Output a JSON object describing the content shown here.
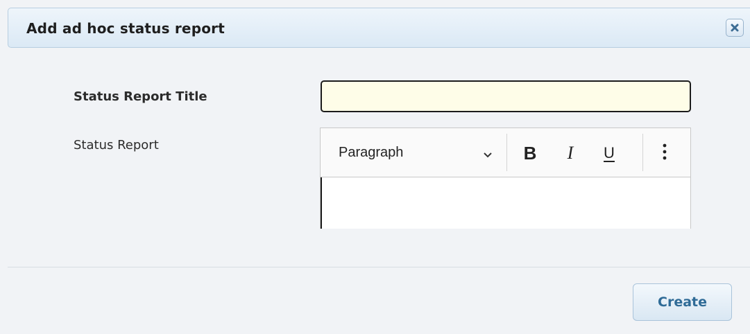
{
  "dialog": {
    "title": "Add ad hoc status report",
    "close_icon": "close-icon"
  },
  "form": {
    "title_label": "Status Report Title",
    "title_value": "",
    "report_label": "Status Report",
    "report_value": ""
  },
  "editor": {
    "block_format": "Paragraph",
    "bold_label": "B",
    "italic_label": "I",
    "underline_label": "U",
    "icons": {
      "dropdown": "chevron-down-icon",
      "more": "more-vertical-icon"
    }
  },
  "footer": {
    "create_label": "Create"
  },
  "colors": {
    "title_input_bg": "#fefde8",
    "button_text": "#2f6b97",
    "titlebar_border": "#b7cde0"
  }
}
